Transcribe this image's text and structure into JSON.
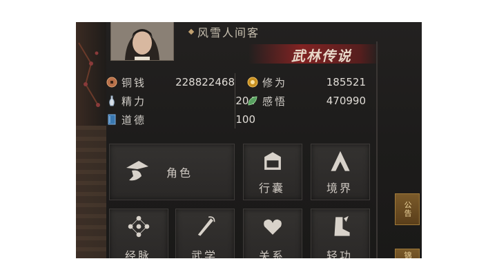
{
  "player": {
    "name": "风雪人间客",
    "banner": "武林传说"
  },
  "stats_left": [
    {
      "icon": "coin-icon",
      "label": "铜钱",
      "value": "228822468"
    },
    {
      "icon": "vase-icon",
      "label": "精力",
      "value": "204"
    },
    {
      "icon": "book-icon",
      "label": "道德",
      "value": "100"
    }
  ],
  "stats_right": [
    {
      "icon": "orb-icon",
      "label": "修为",
      "value": "185521"
    },
    {
      "icon": "leaf-icon",
      "label": "感悟",
      "value": "470990"
    }
  ],
  "menu": {
    "role": "角色",
    "bag": "行囊",
    "realm": "境界",
    "meridian": "经脉",
    "martial": "武学",
    "relation": "关系",
    "lightness": "轻功"
  },
  "side": {
    "notice": "公告",
    "second": "锦标"
  },
  "colors": {
    "banner_red": "#8c2323",
    "accent_gold": "#c0a070"
  }
}
